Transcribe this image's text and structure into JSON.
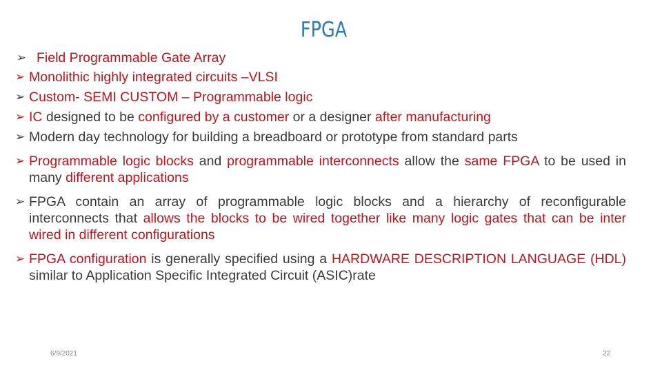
{
  "slide": {
    "title": "FPGA",
    "colors": {
      "title": "#2a7bbd",
      "highlight": "#c8101a",
      "text": "#3a3a3a"
    },
    "bullet_icon": "arrowhead-bullet-icon",
    "bullets": [
      {
        "segments": [
          {
            "text": "Field Programmable Gate Array",
            "style": "red"
          }
        ]
      },
      {
        "segments": [
          {
            "text": "Monolithic highly integrated circuits –VLSI",
            "style": "red"
          }
        ]
      },
      {
        "segments": [
          {
            "text": "Custom- SEMI CUSTOM – Programmable logic",
            "style": "red"
          }
        ]
      },
      {
        "segments": [
          {
            "text": "IC",
            "style": "red"
          },
          {
            "text": " designed to be ",
            "style": "dark"
          },
          {
            "text": "configured by a customer",
            "style": "red"
          },
          {
            "text": " or a designer ",
            "style": "dark"
          },
          {
            "text": "after manufacturing",
            "style": "red"
          }
        ]
      },
      {
        "segments": [
          {
            "text": "Modern day technology for building  a breadboard or prototype from standard parts",
            "style": "dark"
          }
        ]
      },
      {
        "segments": [
          {
            "text": "Programmable logic blocks",
            "style": "red"
          },
          {
            "text": " and ",
            "style": "dark"
          },
          {
            "text": "programmable interconnects",
            "style": "red"
          },
          {
            "text": " allow the ",
            "style": "dark"
          },
          {
            "text": "same FPGA",
            "style": "red"
          },
          {
            "text": " to be used in many ",
            "style": "dark"
          },
          {
            "text": "different applications",
            "style": "red"
          }
        ]
      },
      {
        "segments": [
          {
            "text": "FPGA contain an array of programmable logic blocks and a hierarchy of reconfigurable interconnects that ",
            "style": "dark"
          },
          {
            "text": "allows the blocks to be wired together like many logic gates that can be inter wired in different configurations",
            "style": "red"
          }
        ]
      },
      {
        "segments": [
          {
            "text": "FPGA configuration",
            "style": "red"
          },
          {
            "text": " is generally specified using a ",
            "style": "dark"
          },
          {
            "text": "HARDWARE DESCRIPTION LANGUAGE (HDL)",
            "style": "red"
          },
          {
            "text": " similar to Application Specific Integrated Circuit (ASIC)rate",
            "style": "dark"
          }
        ]
      }
    ]
  },
  "footer": {
    "date": "6/9/2021",
    "page_number": "22"
  }
}
